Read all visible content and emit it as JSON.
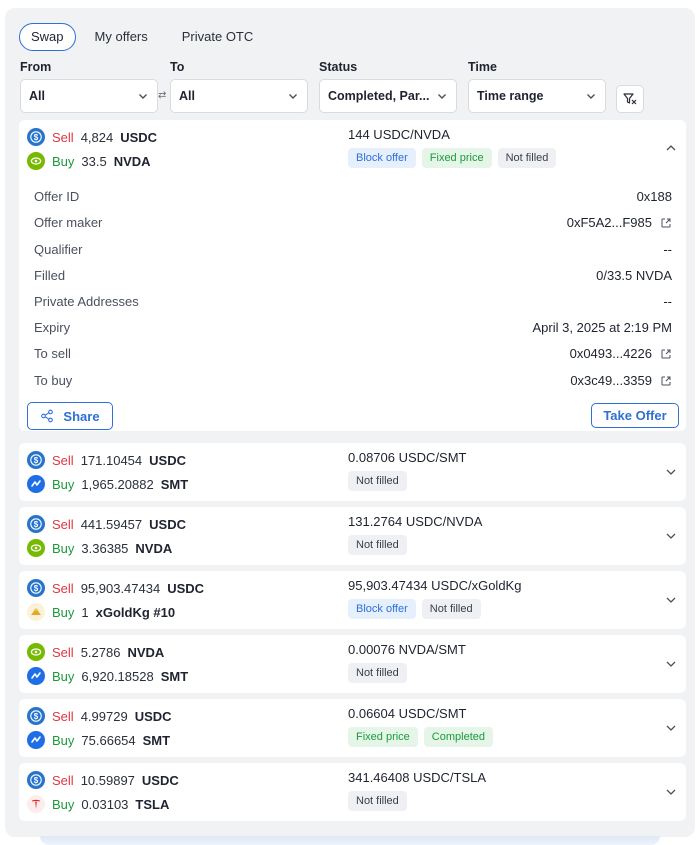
{
  "tabs": [
    "Swap",
    "My offers",
    "Private OTC"
  ],
  "filters": {
    "from": {
      "label": "From",
      "value": "All"
    },
    "to": {
      "label": "To",
      "value": "All"
    },
    "status": {
      "label": "Status",
      "value": "Completed, Par..."
    },
    "time": {
      "label": "Time",
      "value": "Time range"
    }
  },
  "offers": [
    {
      "sell_label": "Sell",
      "sell_amount": "4,824",
      "sell_symbol": "USDC",
      "sell_icon": "usdc-icon",
      "buy_label": "Buy",
      "buy_amount": "33.5",
      "buy_symbol": "NVDA",
      "buy_icon": "nvda-icon",
      "price": "144 USDC/NVDA",
      "badges": [
        {
          "text": "Block offer",
          "style": "blue"
        },
        {
          "text": "Fixed price",
          "style": "green"
        },
        {
          "text": "Not filled",
          "style": "grey"
        }
      ],
      "expanded": true
    },
    {
      "sell_label": "Sell",
      "sell_amount": "171.10454",
      "sell_symbol": "USDC",
      "sell_icon": "usdc-icon",
      "buy_label": "Buy",
      "buy_amount": "1,965.20882",
      "buy_symbol": "SMT",
      "buy_icon": "smt-icon",
      "price": "0.08706 USDC/SMT",
      "badges": [
        {
          "text": "Not filled",
          "style": "grey"
        }
      ]
    },
    {
      "sell_label": "Sell",
      "sell_amount": "441.59457",
      "sell_symbol": "USDC",
      "sell_icon": "usdc-icon",
      "buy_label": "Buy",
      "buy_amount": "3.36385",
      "buy_symbol": "NVDA",
      "buy_icon": "nvda-icon",
      "price": "131.2764 USDC/NVDA",
      "badges": [
        {
          "text": "Not filled",
          "style": "grey"
        }
      ]
    },
    {
      "sell_label": "Sell",
      "sell_amount": "95,903.47434",
      "sell_symbol": "USDC",
      "sell_icon": "usdc-icon",
      "buy_label": "Buy",
      "buy_amount": "1",
      "buy_symbol": "xGoldKg #10",
      "buy_icon": "gold-icon",
      "price": "95,903.47434 USDC/xGoldKg",
      "badges": [
        {
          "text": "Block offer",
          "style": "blue"
        },
        {
          "text": "Not filled",
          "style": "grey"
        }
      ]
    },
    {
      "sell_label": "Sell",
      "sell_amount": "5.2786",
      "sell_symbol": "NVDA",
      "sell_icon": "nvda-icon",
      "buy_label": "Buy",
      "buy_amount": "6,920.18528",
      "buy_symbol": "SMT",
      "buy_icon": "smt-icon",
      "price": "0.00076 NVDA/SMT",
      "badges": [
        {
          "text": "Not filled",
          "style": "grey"
        }
      ]
    },
    {
      "sell_label": "Sell",
      "sell_amount": "4.99729",
      "sell_symbol": "USDC",
      "sell_icon": "usdc-icon",
      "buy_label": "Buy",
      "buy_amount": "75.66654",
      "buy_symbol": "SMT",
      "buy_icon": "smt-icon",
      "price": "0.06604 USDC/SMT",
      "badges": [
        {
          "text": "Fixed price",
          "style": "green"
        },
        {
          "text": "Completed",
          "style": "green"
        }
      ]
    },
    {
      "sell_label": "Sell",
      "sell_amount": "10.59897",
      "sell_symbol": "USDC",
      "sell_icon": "usdc-icon",
      "buy_label": "Buy",
      "buy_amount": "0.03103",
      "buy_symbol": "TSLA",
      "buy_icon": "tsla-icon",
      "price": "341.46408 USDC/TSLA",
      "badges": [
        {
          "text": "Not filled",
          "style": "grey"
        }
      ]
    }
  ],
  "details": {
    "rows": [
      {
        "key": "Offer ID",
        "value": "0x188",
        "link": false
      },
      {
        "key": "Offer maker",
        "value": "0xF5A2...F985",
        "link": true
      },
      {
        "key": "Qualifier",
        "value": "--",
        "link": false
      },
      {
        "key": "Filled",
        "value": "0/33.5 NVDA",
        "link": false
      },
      {
        "key": "Private Addresses",
        "value": "--",
        "link": false
      },
      {
        "key": "Expiry",
        "value": "April 3, 2025 at 2:19 PM",
        "link": false
      },
      {
        "key": "To sell",
        "value": "0x0493...4226",
        "link": true
      },
      {
        "key": "To buy",
        "value": "0x3c49...3359",
        "link": true
      }
    ],
    "share_label": "Share",
    "take_offer_label": "Take Offer"
  },
  "colors": {
    "accent": "#2f6fd6",
    "sell": "#e0363f",
    "buy": "#1a9a3a",
    "usdc": "#2775ca",
    "nvda": "#76b900",
    "smt": "#1e6ee8",
    "tsla": "#e82127"
  }
}
